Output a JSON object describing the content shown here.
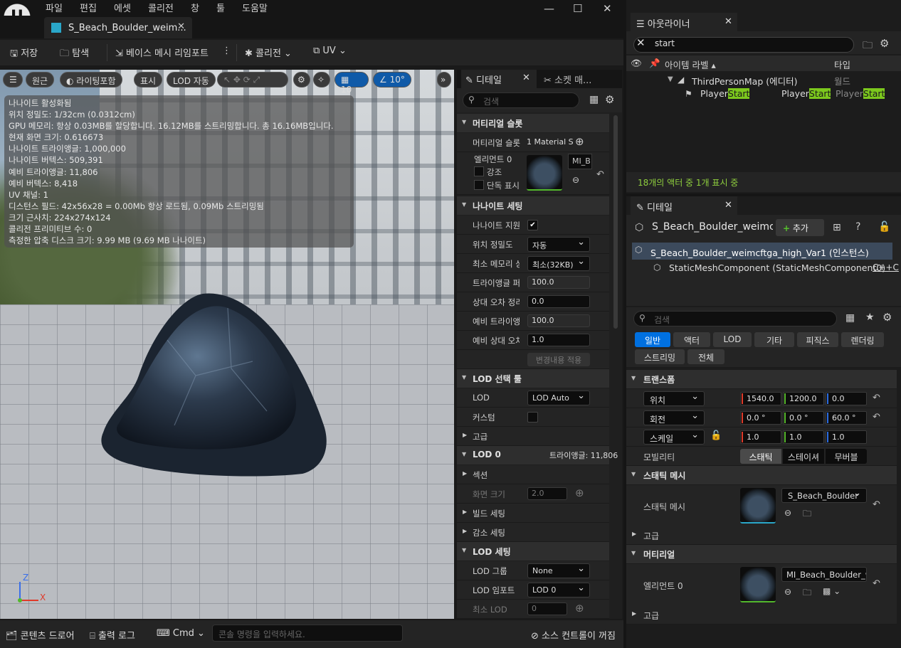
{
  "menubar": {
    "items": [
      "파일",
      "편집",
      "에셋",
      "콜리전",
      "창",
      "툴",
      "도움말"
    ]
  },
  "document_tab": {
    "title": "S_Beach_Boulder_weim..."
  },
  "toolbar": {
    "save": "저장",
    "browse": "탐색",
    "reimport": "베이스 메시 리임포트",
    "collision": "콜리전",
    "uv": "UV"
  },
  "viewport": {
    "buttons": {
      "perspective": "원근",
      "lit": "라이팅포함",
      "show": "표시",
      "lod": "LOD 자동",
      "grid": "10",
      "angle": "10°"
    },
    "stats": [
      "나나이트 활성화됨",
      "위치 정밀도: 1/32cm (0.0312cm)",
      "GPU 메모리: 항상 0.03MB를 할당합니다. 16.12MB를 스트리밍합니다. 총 16.16MB입니다.",
      "현재 화면 크기: 0.616673",
      "나나이트 트라이앵글: 1,000,000",
      "나나이트 버텍스: 509,391",
      "예비 트라이앵글: 11,806",
      "예비 버텍스: 8,418",
      "UV 채널: 1",
      "디스턴스 필드: 42x56x28 = 0.00Mb 항상 로드됨, 0.09Mb 스트리밍됨",
      "크기 근사치: 224x274x124",
      "콜리전 프리미티브 수: 0",
      "측정한 압축 디스크 크기: 9.99 MB (9.69 MB 나나이트)"
    ],
    "axes": {
      "z": "Z",
      "x": "X"
    },
    "colors": {
      "z": "#3a6fe8",
      "x": "#e03a2a",
      "y": "#53b82c"
    }
  },
  "mesh_details": {
    "tabs": {
      "details": "디테일",
      "sockets": "소켓 매..."
    },
    "search_placeholder": "검색",
    "sections": {
      "material_slots": "머티리얼 슬롯",
      "nanite": "나나이트 세팅",
      "lod_picker": "LOD 선택 툴",
      "advanced": "고급",
      "lod0": "LOD 0",
      "lod_settings": "LOD 세팅"
    },
    "material_slots_label": "머티리얼 슬롯",
    "material_slots_value": "1 Material S",
    "element0": "엘리먼트 0",
    "highlight": "강조",
    "isolate": "단독 표시",
    "material_name": "MI_B",
    "nanite_rows": {
      "enabled": "나나이트 지원",
      "position_precision": "위치 정밀도",
      "position_precision_value": "자동",
      "min_residency": "최소 메모리 상",
      "min_residency_value": "최소(32KB)",
      "keep_triangle": "트라이앵글 퍼",
      "keep_triangle_value": "100.0",
      "trim_rel_error": "상대 오차 정리",
      "trim_rel_error_value": "0.0",
      "fallback_triangle": "예비 트라이앵",
      "fallback_triangle_value": "100.0",
      "fallback_rel_error": "예비 상대 오차",
      "fallback_rel_error_value": "1.0",
      "apply": "변경내용 적용"
    },
    "lod_picker_rows": {
      "lod": "LOD",
      "lod_value": "LOD Auto",
      "custom": "커스텀"
    },
    "lod0_triangles": "트라이앵글: 11,806",
    "lod0_rows": {
      "sections": "섹션",
      "screen_size": "화면 크기",
      "screen_size_value": "2.0",
      "build": "빌드 세팅",
      "reduction": "감소 세팅"
    },
    "lod_settings_rows": {
      "group": "LOD 그룹",
      "group_value": "None",
      "import": "LOD 임포트",
      "import_value": "LOD 0",
      "min_lod": "최소 LOD",
      "min_lod_value": "0"
    }
  },
  "statusbar": {
    "content_drawer": "콘텐츠 드로어",
    "output_log": "출력 로그",
    "cmd": "Cmd",
    "cmd_placeholder": "콘솔 명령을 입력하세요.",
    "source_control": "소스 컨트롤이 꺼짐"
  },
  "outliner": {
    "tab": "아웃라이너",
    "search_value": "start",
    "col_label": "아이템 라벨 ▴",
    "col_type": "타입",
    "map_row": {
      "name": "ThirdPersonMap (에디터)",
      "type": "월드"
    },
    "actor_row": {
      "prefix": "Player",
      "hl": "Start"
    },
    "status": "18개의 액터 중 1개 표시 중"
  },
  "level_details": {
    "tab": "디테일",
    "actor_name": "S_Beach_Boulder_weimc",
    "add_button": "추가",
    "instance": "S_Beach_Boulder_weimcftga_high_Var1 (인스턴스)",
    "component": "StaticMeshComponent (StaticMeshComponent0)",
    "component_suffix": "C++C",
    "search_placeholder": "검색",
    "categories": [
      "일반",
      "액터",
      "LOD",
      "기타",
      "피직스",
      "렌더링",
      "스트리밍",
      "전체"
    ],
    "transform": {
      "header": "트랜스폼",
      "location": "위치",
      "rotation": "회전",
      "scale": "스케일",
      "loc": [
        "1540.0",
        "1200.0",
        "0.0"
      ],
      "rot": [
        "0.0 °",
        "0.0 °",
        "60.0 °"
      ],
      "scl": [
        "1.0",
        "1.0",
        "1.0"
      ],
      "mobility": "모빌리티",
      "mobility_options": [
        "스태틱",
        "스테이셔",
        "무버블"
      ]
    },
    "static_mesh_section": {
      "header": "스태틱 메시",
      "label": "스태틱 메시",
      "value": "S_Beach_Boulder"
    },
    "advanced": "고급",
    "materials_section": {
      "header": "머티리얼",
      "label": "엘리먼트 0",
      "value": "MI_Beach_Boulder_wei"
    },
    "advanced2": "고급"
  }
}
